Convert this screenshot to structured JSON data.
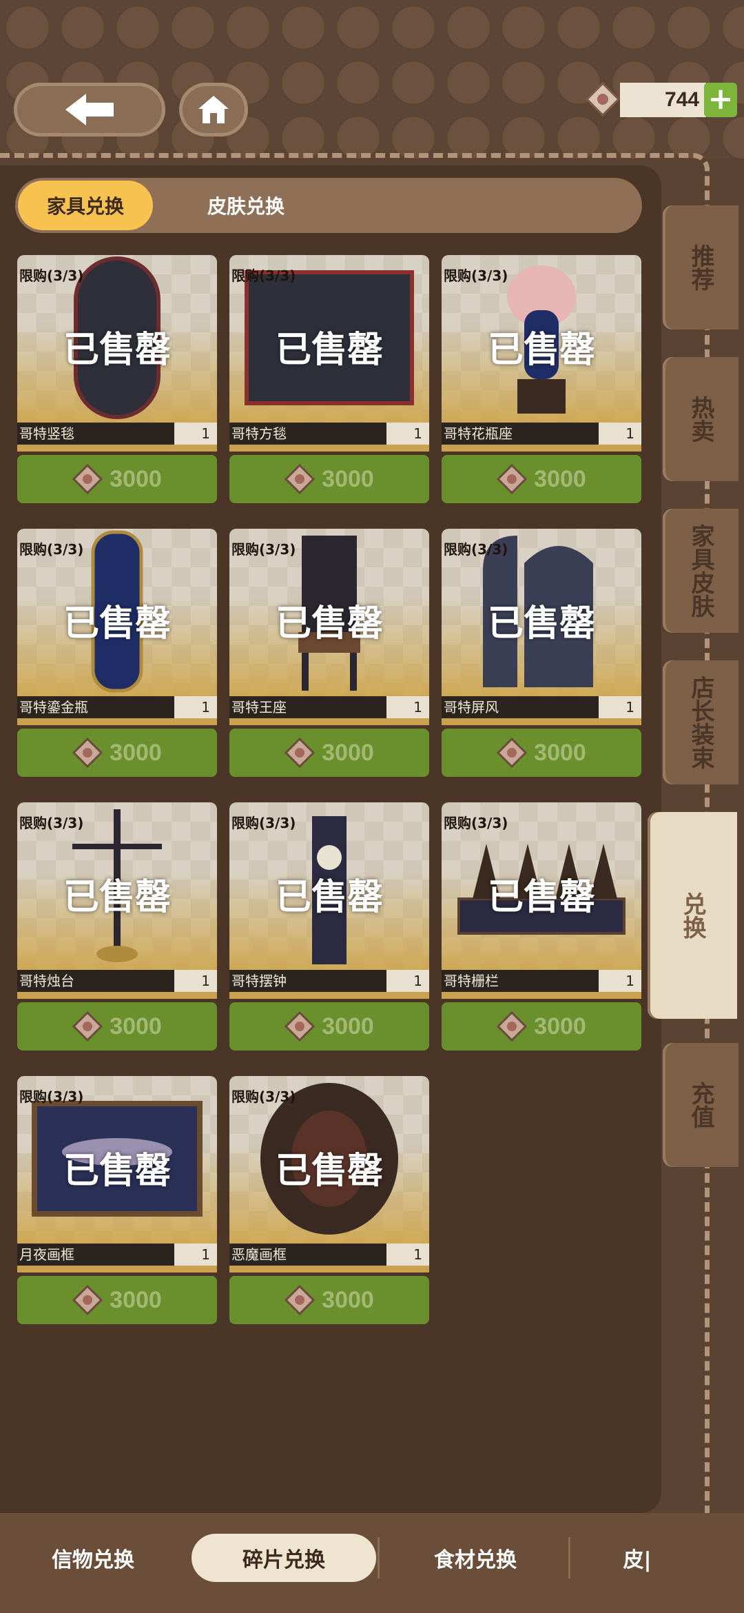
{
  "header": {
    "back_icon": "arrow-left-icon",
    "home_icon": "home-icon",
    "currency": {
      "icon": "gem-icon",
      "amount": "744",
      "plus": "+"
    }
  },
  "tabs": [
    {
      "label": "家具兑换",
      "active": true
    },
    {
      "label": "皮肤兑换",
      "active": false
    }
  ],
  "items": [
    {
      "limit": "限购(3/3)",
      "status": "已售罄",
      "name": "哥特竖毯",
      "qty": "1",
      "price": "3000"
    },
    {
      "limit": "限购(3/3)",
      "status": "已售罄",
      "name": "哥特方毯",
      "qty": "1",
      "price": "3000"
    },
    {
      "limit": "限购(3/3)",
      "status": "已售罄",
      "name": "哥特花瓶座",
      "qty": "1",
      "price": "3000"
    },
    {
      "limit": "限购(3/3)",
      "status": "已售罄",
      "name": "哥特鎏金瓶",
      "qty": "1",
      "price": "3000"
    },
    {
      "limit": "限购(3/3)",
      "status": "已售罄",
      "name": "哥特王座",
      "qty": "1",
      "price": "3000"
    },
    {
      "limit": "限购(3/3)",
      "status": "已售罄",
      "name": "哥特屏风",
      "qty": "1",
      "price": "3000"
    },
    {
      "limit": "限购(3/3)",
      "status": "已售罄",
      "name": "哥特烛台",
      "qty": "1",
      "price": "3000"
    },
    {
      "limit": "限购(3/3)",
      "status": "已售罄",
      "name": "哥特摆钟",
      "qty": "1",
      "price": "3000"
    },
    {
      "limit": "限购(3/3)",
      "status": "已售罄",
      "name": "哥特栅栏",
      "qty": "1",
      "price": "3000"
    },
    {
      "limit": "限购(3/3)",
      "status": "已售罄",
      "name": "月夜画框",
      "qty": "1",
      "price": "3000"
    },
    {
      "limit": "限购(3/3)",
      "status": "已售罄",
      "name": "恶魔画框",
      "qty": "1",
      "price": "3000"
    }
  ],
  "side_tabs": [
    {
      "label": "推荐",
      "active": false
    },
    {
      "label": "热卖",
      "active": false
    },
    {
      "label": "家具皮肤",
      "active": false
    },
    {
      "label": "店长装束",
      "active": false
    },
    {
      "label": "兑换",
      "active": true
    },
    {
      "label": "充值",
      "active": false
    }
  ],
  "bottom_tabs": [
    {
      "label": "信物兑换",
      "active": false
    },
    {
      "label": "碎片兑换",
      "active": true
    },
    {
      "label": "食材兑换",
      "active": false
    },
    {
      "label": "皮|",
      "active": false
    }
  ],
  "colors": {
    "accent_tab": "#f7c24f",
    "price_green": "#6a8f2d",
    "plus_green": "#7cb53a",
    "panel_brown": "#4b3526"
  }
}
